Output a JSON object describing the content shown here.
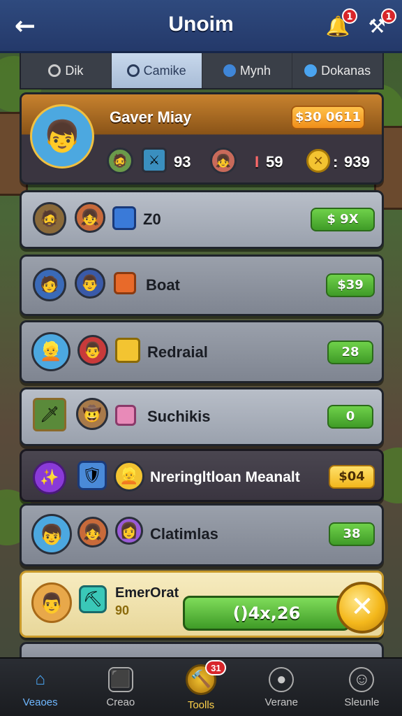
{
  "header": {
    "title": "Unoim",
    "back_icon": "arrow-left-icon",
    "bell_badge": "1",
    "tools_badge": "1"
  },
  "tabs": [
    {
      "label": "Dik",
      "icon": "circle-icon",
      "active": false
    },
    {
      "label": "Camike",
      "icon": "pin-icon",
      "active": true
    },
    {
      "label": "Mynh",
      "icon": "globe-icon",
      "active": false
    },
    {
      "label": "Dokanas",
      "icon": "blue-orb-icon",
      "active": false
    }
  ],
  "hero": {
    "name": "Gaver Miay",
    "reward": "$30 0611",
    "stat1": "93",
    "stat2": "59",
    "stat3": "939",
    "stat_prefix2": "I",
    "stat_prefix3": ":"
  },
  "rows": [
    {
      "label": "Z0",
      "value": "$ 9X"
    },
    {
      "label": "Boat",
      "value": "$39"
    },
    {
      "label": "Redraial",
      "value": "28"
    },
    {
      "label": "Suchikis",
      "value": "0"
    },
    {
      "label": "Nreringltloan Meanalt",
      "value": "$04"
    },
    {
      "label": "Clatimlas",
      "value": "38"
    },
    {
      "label": "EmerOrat",
      "sub": "90",
      "value": ""
    }
  ],
  "action": {
    "button_label": "()4x,26",
    "close_icon": "x-coin-icon"
  },
  "bottom_nav": [
    {
      "label": "Veaoes",
      "icon": "house-icon",
      "state": "active"
    },
    {
      "label": "Creao",
      "icon": "box-icon",
      "state": "normal"
    },
    {
      "label": "Toolls",
      "icon": "tools-icon",
      "state": "featured",
      "badge": "31"
    },
    {
      "label": "Verane",
      "icon": "controller-icon",
      "state": "normal"
    },
    {
      "label": "Sleunle",
      "icon": "person-icon",
      "state": "normal"
    }
  ]
}
